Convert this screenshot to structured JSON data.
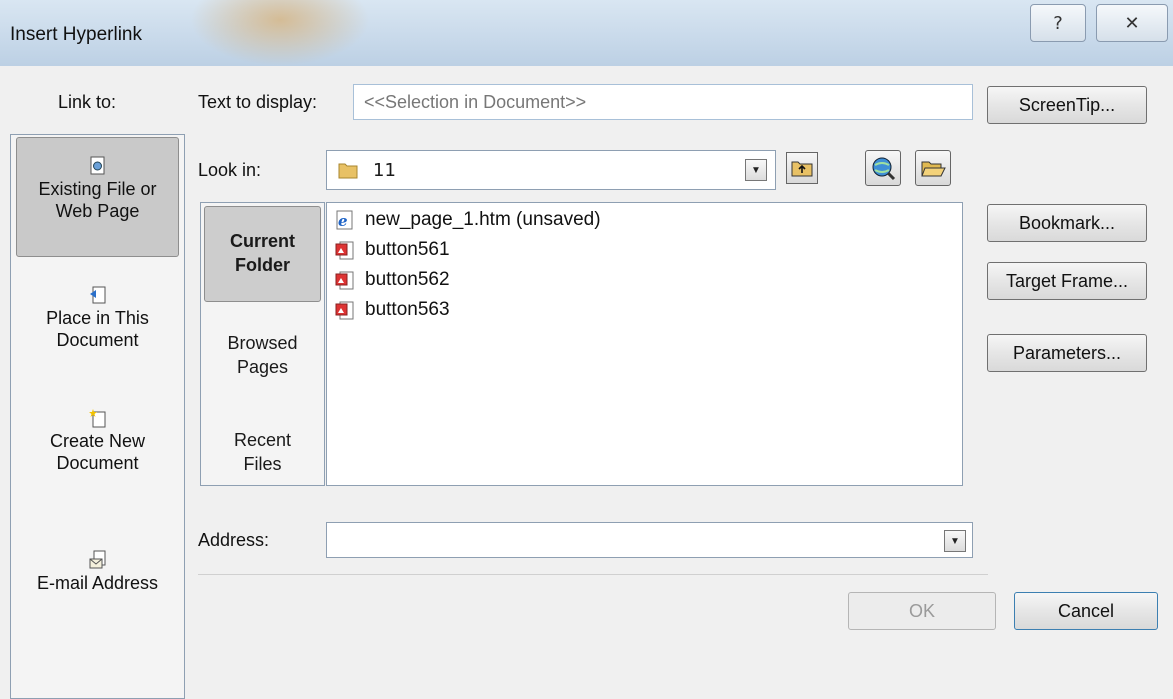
{
  "window": {
    "title": "Insert Hyperlink",
    "help_glyph": "?",
    "close_glyph": "✕"
  },
  "link_to": {
    "label": "Link to:",
    "items": [
      {
        "label_line1": "Existing File or",
        "label_line2": "Web Page",
        "icon": "existing-file-icon",
        "selected": true
      },
      {
        "label_line1": "Place in This",
        "label_line2": "Document",
        "icon": "place-in-document-icon",
        "selected": false
      },
      {
        "label_line1": "Create New",
        "label_line2": "Document",
        "icon": "new-document-icon",
        "selected": false
      },
      {
        "label_line1": "E-mail Address",
        "label_line2": "",
        "icon": "email-icon",
        "selected": false
      }
    ]
  },
  "text_to_display": {
    "label": "Text to display:",
    "value": "<<Selection in Document>>"
  },
  "look_in": {
    "label": "Look in:",
    "value": "11"
  },
  "places": [
    {
      "line1": "Current",
      "line2": "Folder",
      "selected": true
    },
    {
      "line1": "Browsed",
      "line2": "Pages",
      "selected": false
    },
    {
      "line1": "Recent",
      "line2": "Files",
      "selected": false
    }
  ],
  "files": [
    {
      "name": "new_page_1.htm (unsaved)",
      "icon": "ie-page-icon"
    },
    {
      "name": "button561",
      "icon": "image-file-icon"
    },
    {
      "name": "button562",
      "icon": "image-file-icon"
    },
    {
      "name": "button563",
      "icon": "image-file-icon"
    }
  ],
  "address": {
    "label": "Address:",
    "value": ""
  },
  "buttons": {
    "screentip": "ScreenTip...",
    "bookmark": "Bookmark...",
    "target_frame": "Target Frame...",
    "parameters": "Parameters...",
    "ok": "OK",
    "cancel": "Cancel"
  },
  "colors": {
    "titlebar": "#c8d9ea",
    "dialog_bg": "#f0f0f0",
    "field_border": "#8e9fb2",
    "selected_item": "#c9c9c9"
  }
}
